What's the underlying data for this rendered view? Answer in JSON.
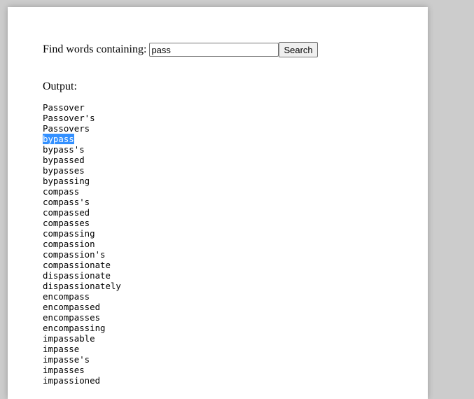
{
  "form": {
    "label": "Find words containing:",
    "query_value": "pass",
    "search_button_label": "Search"
  },
  "output": {
    "label": "Output:",
    "selected_word": "bypass",
    "words": [
      "Passover",
      "Passover's",
      "Passovers",
      "bypass",
      "bypass's",
      "bypassed",
      "bypasses",
      "bypassing",
      "compass",
      "compass's",
      "compassed",
      "compasses",
      "compassing",
      "compassion",
      "compassion's",
      "compassionate",
      "dispassionate",
      "dispassionately",
      "encompass",
      "encompassed",
      "encompasses",
      "encompassing",
      "impassable",
      "impasse",
      "impasse's",
      "impasses",
      "impassioned"
    ]
  }
}
